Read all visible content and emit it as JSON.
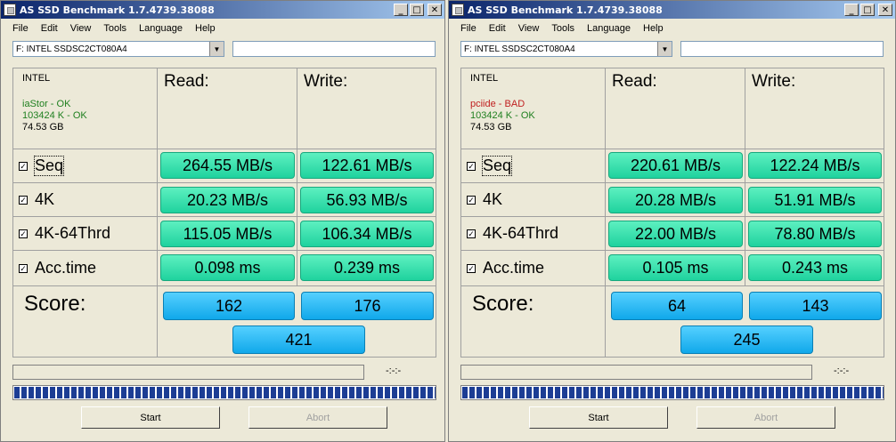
{
  "windows": [
    {
      "title": "AS SSD Benchmark 1.7.4739.38088",
      "menu": [
        "File",
        "Edit",
        "View",
        "Tools",
        "Language",
        "Help"
      ],
      "drive_select": "F: INTEL SSDSC2CT080A4",
      "info": {
        "vendor": "INTEL",
        "driver": "iaStor - OK",
        "driver_status": "ok",
        "align": "103424 K - OK",
        "size": "74.53 GB"
      },
      "headers": {
        "read": "Read:",
        "write": "Write:"
      },
      "rows": [
        {
          "label": "Seq",
          "read": "264.55 MB/s",
          "write": "122.61 MB/s"
        },
        {
          "label": "4K",
          "read": "20.23 MB/s",
          "write": "56.93 MB/s"
        },
        {
          "label": "4K-64Thrd",
          "read": "115.05 MB/s",
          "write": "106.34 MB/s"
        },
        {
          "label": "Acc.time",
          "read": "0.098 ms",
          "write": "0.239 ms"
        }
      ],
      "check": "✓",
      "score_label": "Score:",
      "score": {
        "read": "162",
        "write": "176",
        "total": "421"
      },
      "time": "-:-:-",
      "start": "Start",
      "abort": "Abort"
    },
    {
      "title": "AS SSD Benchmark 1.7.4739.38088",
      "menu": [
        "File",
        "Edit",
        "View",
        "Tools",
        "Language",
        "Help"
      ],
      "drive_select": "F: INTEL SSDSC2CT080A4",
      "info": {
        "vendor": "INTEL",
        "driver": "pciide - BAD",
        "driver_status": "bad",
        "align": "103424 K - OK",
        "size": "74.53 GB"
      },
      "headers": {
        "read": "Read:",
        "write": "Write:"
      },
      "rows": [
        {
          "label": "Seq",
          "read": "220.61 MB/s",
          "write": "122.24 MB/s"
        },
        {
          "label": "4K",
          "read": "20.28 MB/s",
          "write": "51.91 MB/s"
        },
        {
          "label": "4K-64Thrd",
          "read": "22.00 MB/s",
          "write": "78.80 MB/s"
        },
        {
          "label": "Acc.time",
          "read": "0.105 ms",
          "write": "0.243 ms"
        }
      ],
      "check": "✓",
      "score_label": "Score:",
      "score": {
        "read": "64",
        "write": "143",
        "total": "245"
      },
      "time": "-:-:-",
      "start": "Start",
      "abort": "Abort"
    }
  ],
  "colors": {
    "result_green": "#2fe0b0",
    "score_blue": "#1bb6f5",
    "title_blue": "#0a246a",
    "bad_red": "#c02020",
    "ok_green": "#208020"
  }
}
